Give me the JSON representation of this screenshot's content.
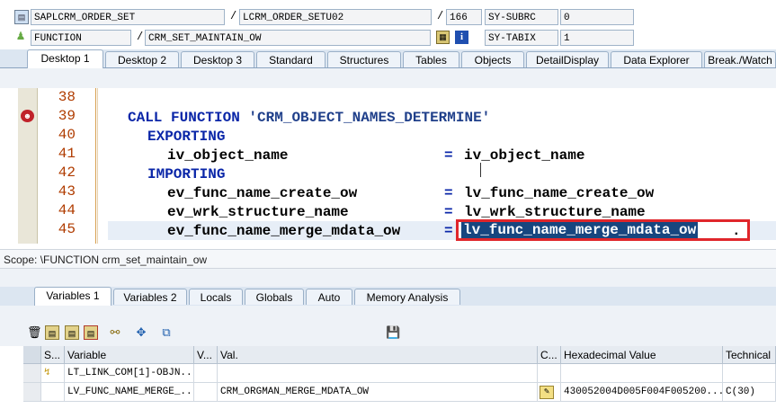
{
  "header": {
    "row1": {
      "program": "SAPLCRM_ORDER_SET",
      "include": "LCRM_ORDER_SETU02",
      "line": "166",
      "sysvar_name": "SY-SUBRC",
      "sysvar_value": "0"
    },
    "row2": {
      "type": "FUNCTION",
      "name": "CRM_SET_MAINTAIN_OW",
      "sysvar_name": "SY-TABIX",
      "sysvar_value": "1"
    },
    "slash": "/"
  },
  "desktop_tabs": [
    "Desktop 1",
    "Desktop 2",
    "Desktop 3",
    "Standard",
    "Structures",
    "Tables",
    "Objects",
    "DetailDisplay",
    "Data Explorer",
    "Break./Watch"
  ],
  "code": {
    "line_numbers": [
      "38",
      "39",
      "40",
      "41",
      "42",
      "43",
      "44",
      "45"
    ],
    "lines": [
      {
        "kw": "CALL FUNCTION",
        "rest": " 'CRM_OBJECT_NAMES_DETERMINE'"
      },
      {
        "kw": "EXPORTING",
        "rest": ""
      },
      {
        "kw": "",
        "rest": "iv_object_name",
        "assign": "=",
        "value": "iv_object_name"
      },
      {
        "kw": "IMPORTING",
        "rest": ""
      },
      {
        "kw": "",
        "rest": "ev_func_name_create_ow",
        "assign": "=",
        "value": "lv_func_name_create_ow"
      },
      {
        "kw": "",
        "rest": "ev_wrk_structure_name",
        "assign": "=",
        "value": "lv_wrk_structure_name"
      },
      {
        "kw": "",
        "rest": "ev_func_name_merge_mdata_ow",
        "assign": "=",
        "value": "lv_func_name_merge_mdata_ow",
        "suffix": "."
      }
    ]
  },
  "scope_text": "Scope: \\FUNCTION crm_set_maintain_ow",
  "variable_tabs": [
    "Variables 1",
    "Variables 2",
    "Locals",
    "Globals",
    "Auto",
    "Memory Analysis"
  ],
  "grid": {
    "columns": [
      "S...",
      "Variable",
      "V...",
      "Val.",
      "C...",
      "Hexadecimal Value",
      "Technical"
    ],
    "rows": [
      {
        "variable": "LT_LINK_COM[1]-OBJN...",
        "value": "",
        "hex": "",
        "tech": ""
      },
      {
        "variable": "LV_FUNC_NAME_MERGE_...",
        "value": "CRM_ORGMAN_MERGE_MDATA_OW",
        "hex": "430052004D005F004F005200...",
        "tech": "C(30)"
      }
    ]
  },
  "colors": {
    "keyword": "#0a26a8",
    "line_number": "#b03c00",
    "highlight_box": "#e0262b",
    "selection": "#17467f",
    "tab_bg": "#dce6f1"
  }
}
